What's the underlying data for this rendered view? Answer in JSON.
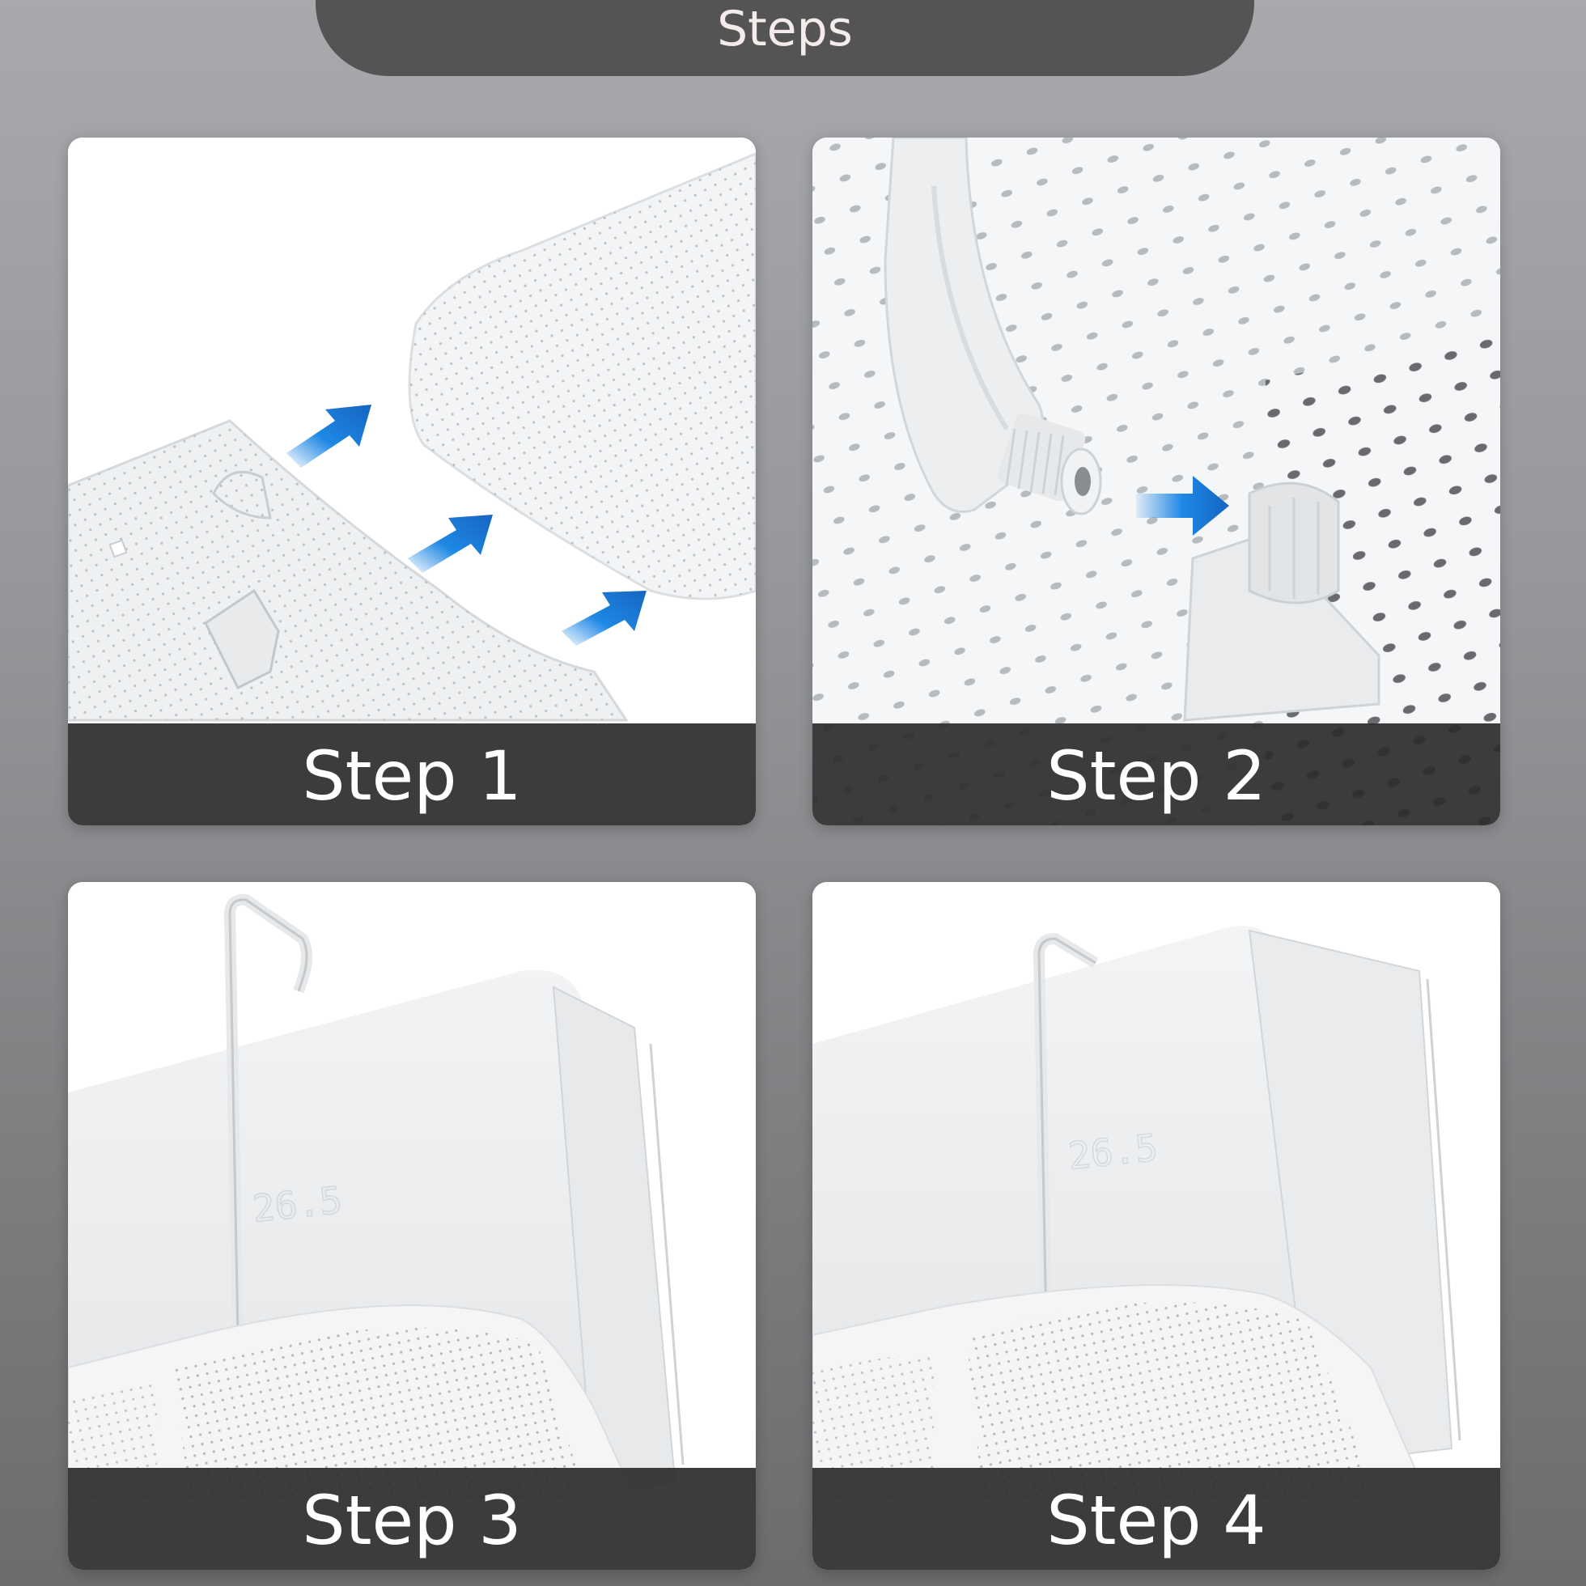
{
  "header": {
    "title": "Steps"
  },
  "steps": [
    {
      "label": "Step 1",
      "illustration": "panels-joining-arrows"
    },
    {
      "label": "Step 2",
      "illustration": "bracket-clip-insert"
    },
    {
      "label": "Step 3",
      "illustration": "hook-on-ac-unit"
    },
    {
      "label": "Step 4",
      "illustration": "deflector-mounted-on-ac-unit"
    }
  ],
  "colors": {
    "background": "#9a9c9f",
    "header_tab": "#545454",
    "caption_bar": "#2d2d2d",
    "arrow_blue": "#1e88e5",
    "panel_white": "#f4f4f4"
  }
}
